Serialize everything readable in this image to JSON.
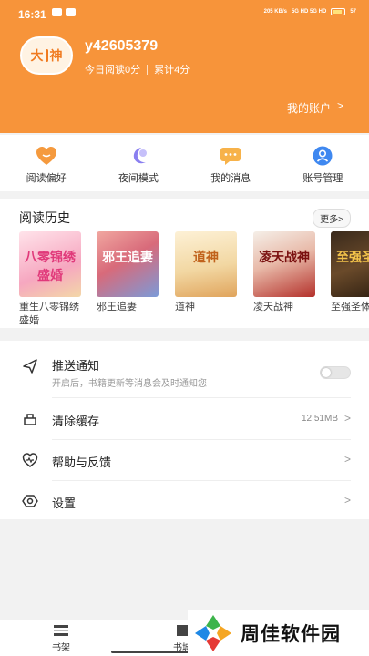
{
  "status_bar": {
    "time": "16:31",
    "net_speed": "205 KB/s",
    "network": "5G HD 5G HD",
    "battery": "57"
  },
  "profile": {
    "avatar_text_1": "大",
    "avatar_text_2": "神",
    "username": "y42605379",
    "today_reading": "今日阅读0分",
    "total": "累计4分",
    "account_link": "我的账户",
    "chevron": ">"
  },
  "quick_menu": [
    {
      "label": "阅读偏好",
      "icon": "heart-icon"
    },
    {
      "label": "夜间模式",
      "icon": "moon-icon"
    },
    {
      "label": "我的消息",
      "icon": "message-icon"
    },
    {
      "label": "账号管理",
      "icon": "user-icon"
    }
  ],
  "history": {
    "title": "阅读历史",
    "more": "更多>",
    "books": [
      {
        "title": "重生八零锦绣盛婚",
        "cover_text": "八零锦绣盛婚"
      },
      {
        "title": "邪王追妻",
        "cover_text": "邪王追妻"
      },
      {
        "title": "道神",
        "cover_text": "道神"
      },
      {
        "title": "凌天战神",
        "cover_text": "凌天战神"
      },
      {
        "title": "至强圣体",
        "cover_text": "至强圣体"
      }
    ]
  },
  "settings": {
    "push": {
      "label": "推送通知",
      "sub": "开启后，书籍更新等消息会及时通知您",
      "enabled": false
    },
    "cache": {
      "label": "清除缓存",
      "value": "12.51MB",
      "chevron": ">"
    },
    "help": {
      "label": "帮助与反馈",
      "chevron": ">"
    },
    "settings": {
      "label": "设置",
      "chevron": ">"
    }
  },
  "bottom_nav": [
    {
      "label": "书架"
    },
    {
      "label": "书城"
    }
  ],
  "watermark": {
    "text": "周佳软件园"
  },
  "colors": {
    "brand_orange": "#f7943a",
    "background": "#f2f2f2"
  }
}
